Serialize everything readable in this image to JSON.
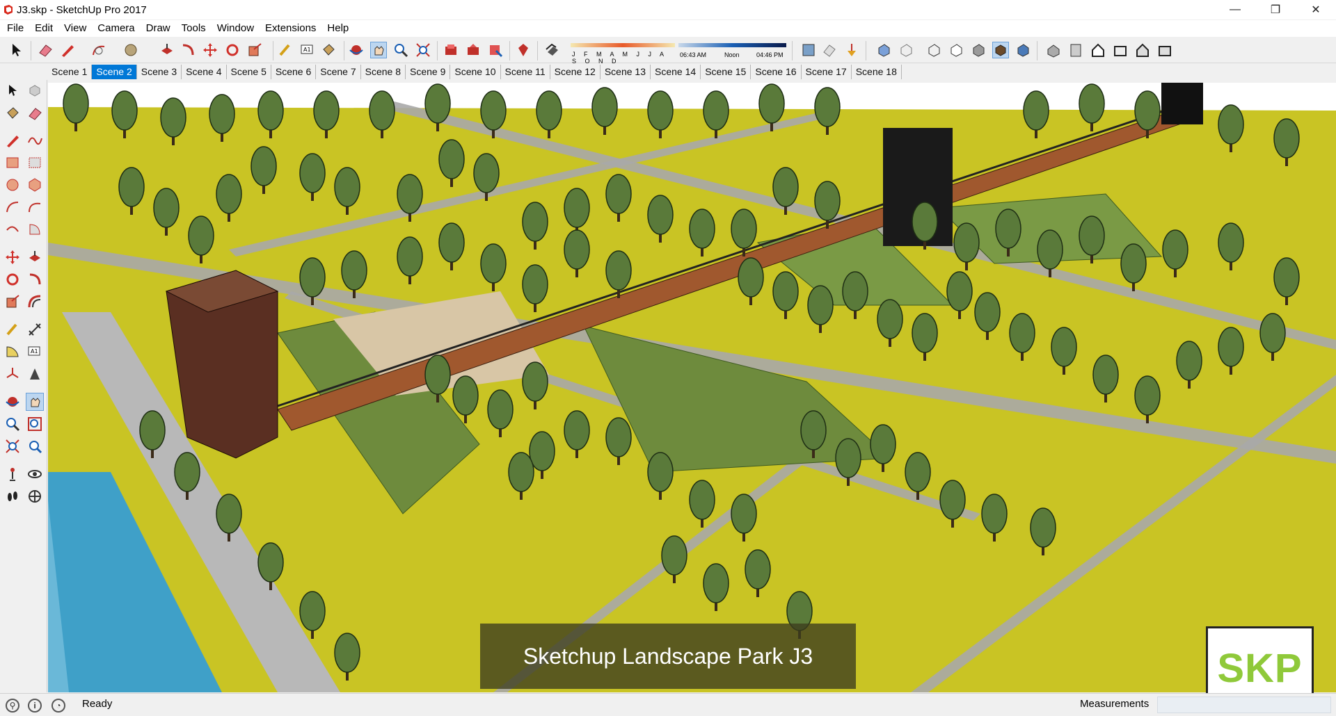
{
  "window": {
    "title": "J3.skp - SketchUp Pro 2017",
    "minimize": "—",
    "maximize": "❐",
    "close": "✕"
  },
  "menu": [
    "File",
    "Edit",
    "View",
    "Camera",
    "Draw",
    "Tools",
    "Window",
    "Extensions",
    "Help"
  ],
  "shadows": {
    "months": "J F M A M J J A S O N D",
    "time_start": "06:43 AM",
    "time_mid": "Noon",
    "time_end": "04:46 PM"
  },
  "scenes": {
    "active_index": 1,
    "tabs": [
      "Scene 1",
      "Scene 2",
      "Scene 3",
      "Scene 4",
      "Scene 5",
      "Scene 6",
      "Scene 7",
      "Scene 8",
      "Scene 9",
      "Scene 10",
      "Scene 11",
      "Scene 12",
      "Scene 13",
      "Scene 14",
      "Scene 15",
      "Scene 16",
      "Scene 17",
      "Scene 18"
    ]
  },
  "viewport": {
    "caption": "Sketchup Landscape Park J3",
    "logo": "SKP",
    "ground_color": "#c9c424"
  },
  "status": {
    "text": "Ready",
    "measurements_label": "Measurements",
    "measurements_value": ""
  },
  "colors": {
    "accent": "#0078d7",
    "logo_green": "#8fc93a"
  }
}
